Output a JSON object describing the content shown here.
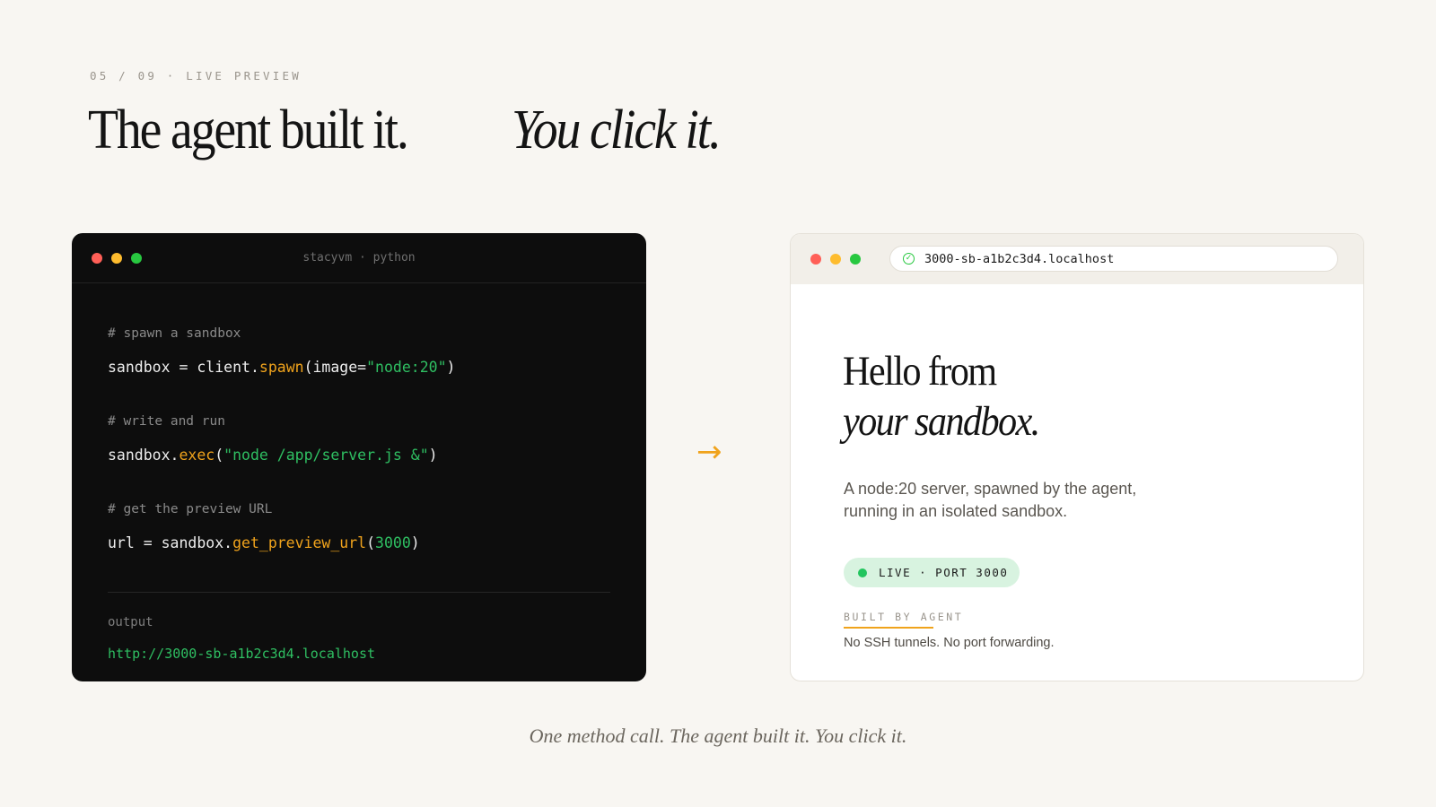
{
  "slide": {
    "eyebrow": "05 / 09 · LIVE PREVIEW",
    "headline_part1": "The agent built it.",
    "headline_part2": "You click it.",
    "caption": "One method call. The agent built it. You click it."
  },
  "terminal": {
    "title": "stacyvm · python",
    "comment_1": "# spawn a sandbox",
    "line_1": {
      "a": "sandbox = client.",
      "fn": "spawn",
      "b": "(image=",
      "str": "\"node:20\"",
      "c": ")"
    },
    "comment_2": "# write and run",
    "line_2": {
      "a": "sandbox.",
      "fn": "exec",
      "b": "(",
      "str": "\"node /app/server.js &\"",
      "c": ")"
    },
    "comment_3": "# get the preview URL",
    "line_3": {
      "a": "url = sandbox.",
      "fn": "get_preview_url",
      "b": "(",
      "num": "3000",
      "c": ")"
    },
    "output_label": "output",
    "output_url": "http://3000-sb-a1b2c3d4.localhost"
  },
  "arrow": "→",
  "browser": {
    "url": "3000-sb-a1b2c3d4.localhost",
    "lock_icon": "✓",
    "heading_line1": "Hello from",
    "heading_line2": "your sandbox.",
    "description": "A node:20 server, spawned by the agent, running in an isolated sandbox.",
    "live_badge": "LIVE · PORT 3000",
    "built_label": "BUILT BY AGENT",
    "built_text": "No SSH tunnels. No port forwarding."
  },
  "colors": {
    "background": "#f8f6f2",
    "terminal_bg": "#0d0d0d",
    "accent_orange": "#f0a31c",
    "accent_green": "#2fbf62",
    "live_green": "#22c55e"
  }
}
